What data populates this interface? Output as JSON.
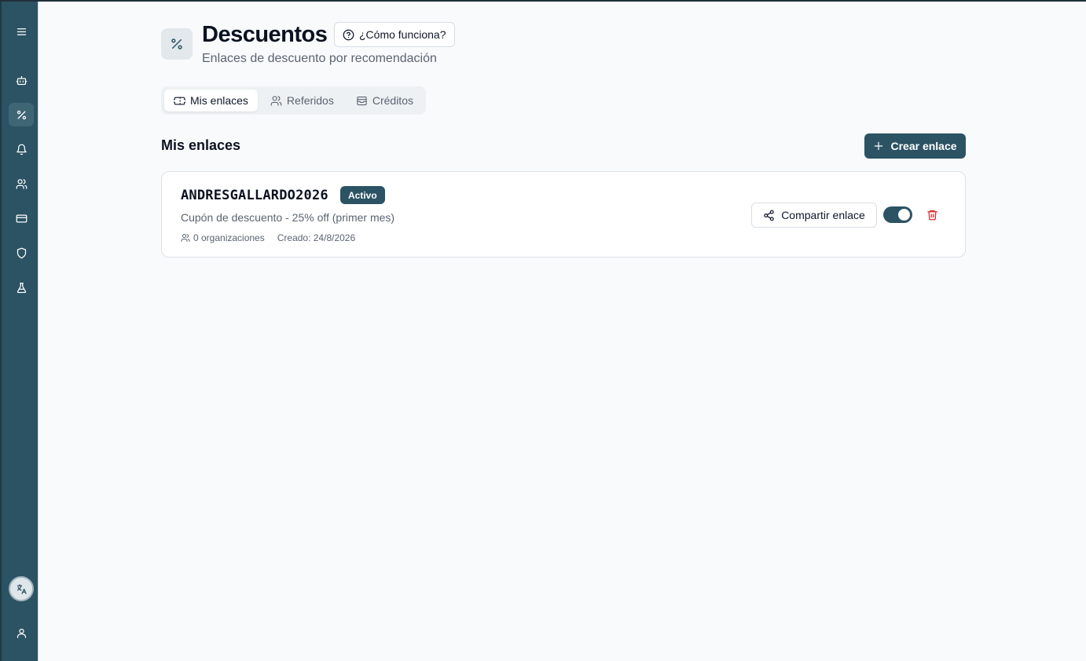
{
  "sidebar": {
    "items": [
      {
        "name": "menu",
        "icon": "menu-icon"
      },
      {
        "name": "bot",
        "icon": "bot-icon"
      },
      {
        "name": "discounts",
        "icon": "percent-icon",
        "active": true
      },
      {
        "name": "notifications",
        "icon": "bell-icon"
      },
      {
        "name": "users",
        "icon": "users-icon"
      },
      {
        "name": "billing",
        "icon": "credit-card-icon"
      },
      {
        "name": "security",
        "icon": "shield-icon"
      },
      {
        "name": "labs",
        "icon": "flask-icon"
      },
      {
        "name": "language",
        "icon": "translate-icon"
      },
      {
        "name": "account",
        "icon": "user-icon"
      }
    ]
  },
  "header": {
    "icon": "percent-icon",
    "title": "Descuentos",
    "help_label": "¿Cómo funciona?",
    "subtitle": "Enlaces de descuento por recomendación"
  },
  "tabs": [
    {
      "label": "Mis enlaces",
      "icon": "ticket-icon",
      "active": true
    },
    {
      "label": "Referidos",
      "icon": "users-icon",
      "active": false
    },
    {
      "label": "Créditos",
      "icon": "wallet-icon",
      "active": false
    }
  ],
  "section": {
    "title": "Mis enlaces",
    "create_label": "Crear enlace"
  },
  "links": [
    {
      "code": "ANDRESGALLARDO2026",
      "status": "Activo",
      "description": "Cupón de descuento - 25% off (primer mes)",
      "organizations": "0 organizaciones",
      "created": "Creado: 24/8/2026",
      "share_label": "Compartir enlace",
      "enabled": true
    }
  ],
  "colors": {
    "primary": "#2b5363",
    "danger": "#dc2626",
    "background": "#f8fafc"
  }
}
